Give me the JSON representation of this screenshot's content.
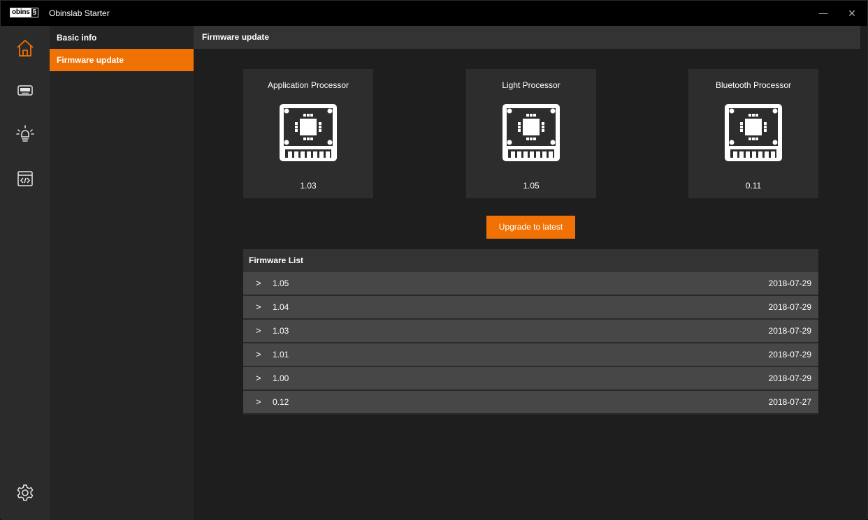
{
  "titlebar": {
    "logo_text": "obins",
    "logo_mark": "§",
    "app_title": "Obinslab Starter",
    "minimize_glyph": "—",
    "close_glyph": "✕"
  },
  "rail": {
    "icons": [
      "home-icon",
      "keyboard-icon",
      "lightbulb-icon",
      "code-window-icon",
      "gear-icon"
    ],
    "accent": "#f07205"
  },
  "submenu": {
    "items": [
      {
        "label": "Basic info",
        "active": false
      },
      {
        "label": "Firmware update",
        "active": true
      }
    ]
  },
  "content": {
    "header": "Firmware update",
    "processors": [
      {
        "name": "Application Processor",
        "version": "1.03",
        "icon": "chip-icon"
      },
      {
        "name": "Light Processor",
        "version": "1.05",
        "icon": "chip-icon"
      },
      {
        "name": "Bluetooth Processor",
        "version": "0.11",
        "icon": "chip-icon"
      }
    ],
    "upgrade_label": "Upgrade to latest",
    "firmware_list": {
      "title": "Firmware List",
      "chevron": ">",
      "rows": [
        {
          "version": "1.05",
          "date": "2018-07-29"
        },
        {
          "version": "1.04",
          "date": "2018-07-29"
        },
        {
          "version": "1.03",
          "date": "2018-07-29"
        },
        {
          "version": "1.01",
          "date": "2018-07-29"
        },
        {
          "version": "1.00",
          "date": "2018-07-29"
        },
        {
          "version": "0.12",
          "date": "2018-07-27"
        }
      ]
    }
  }
}
